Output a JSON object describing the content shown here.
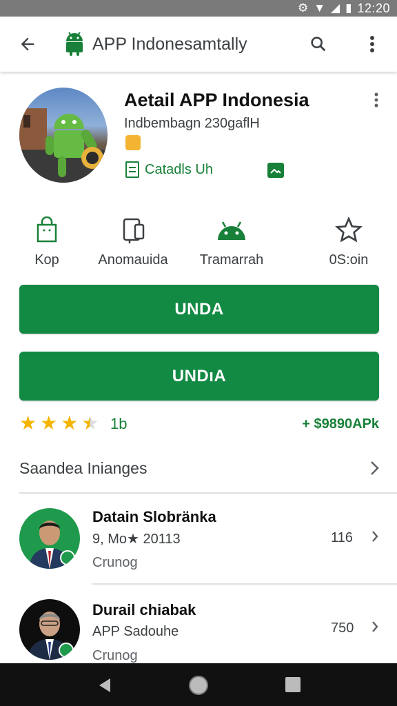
{
  "status_bar": {
    "time": "12:20"
  },
  "app_bar": {
    "title": "APP Indonesamtally"
  },
  "app": {
    "name": "Aetail APP Indonesia",
    "subtitle": "Indbembagn 230gaflH",
    "tag_label": "Catadls Uh"
  },
  "stats": [
    {
      "label": "Kop",
      "icon": "bag-icon"
    },
    {
      "label": "Anomauida",
      "icon": "device-icon"
    },
    {
      "label": "Tramarrah",
      "icon": "android-icon"
    },
    {
      "label": "0S:oin",
      "icon": "star-outline-icon"
    }
  ],
  "buttons": {
    "primary_label": "UNDA",
    "secondary_label": "UNDıA"
  },
  "rating": {
    "stars": 3.5,
    "count": "1b",
    "price": "+ $9890APk"
  },
  "section": {
    "title": "Saandea Inianges"
  },
  "list": [
    {
      "name": "Datain Slobränka",
      "meta": "9, Mo★ 20113",
      "sub": "Crunog",
      "count": "116"
    },
    {
      "name": "Durail chiabak",
      "meta": "APP Sadouhe",
      "sub": "Crunog",
      "count": "750"
    }
  ],
  "colors": {
    "primary": "#138a44",
    "accent_text": "#188038",
    "star": "#f4b400"
  }
}
